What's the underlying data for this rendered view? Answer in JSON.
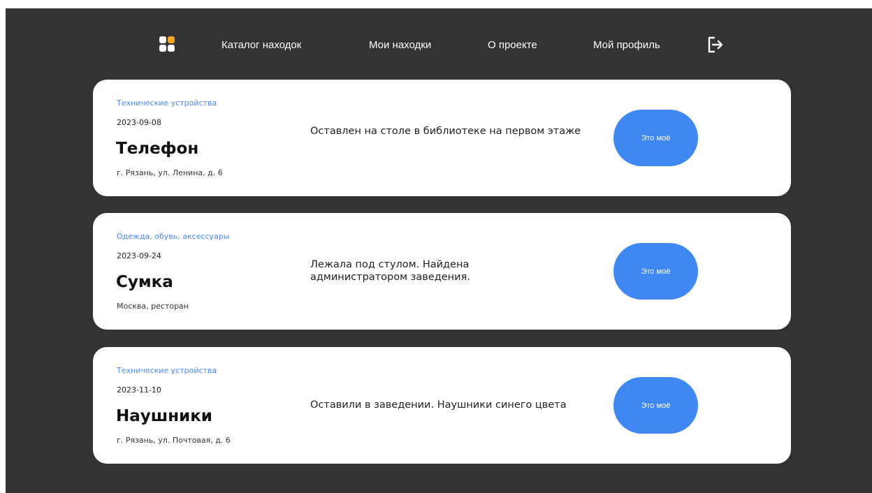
{
  "nav": {
    "links": [
      {
        "label": "Каталог находок"
      },
      {
        "label": "Мои находки"
      },
      {
        "label": "О проекте"
      },
      {
        "label": "Мой профиль"
      }
    ],
    "logo_icon": "app-grid-icon",
    "logout_icon": "logout-icon"
  },
  "items": [
    {
      "category": "Технические устройства",
      "date": "2023-09-08",
      "title": "Телефон",
      "address": "г. Рязань, ул. Ленина, д. 6",
      "description": "Оставлен на столе в библиотеке на первом этаже",
      "button_label": "Это моё"
    },
    {
      "category": "Одежда, обувь, аксессуары",
      "date": "2023-09-24",
      "title": "Сумка",
      "address": "Москва, ресторан",
      "description": "Лежала под стулом. Найдена администратором заведения.",
      "button_label": "Это моё"
    },
    {
      "category": "Технические устройства",
      "date": "2023-11-10",
      "title": "Наушники",
      "address": "г. Рязань, ул. Почтовая, д. 6",
      "description": "Оставили в заведении. Наушники синего цвета",
      "button_label": "Это моё"
    }
  ],
  "colors": {
    "background": "#333333",
    "card": "#ffffff",
    "accent": "#3f88f4",
    "category": "#4a8cf7",
    "logo_orange": "#f5a623",
    "logo_white": "#ffffff"
  }
}
